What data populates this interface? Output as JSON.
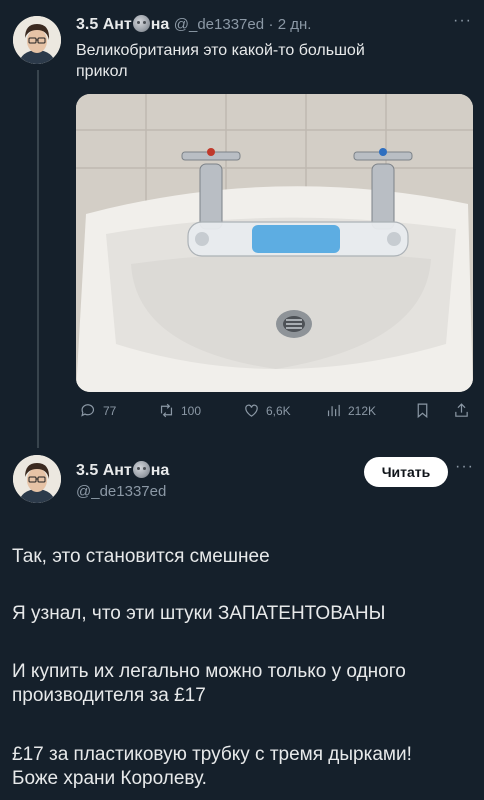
{
  "tweet1": {
    "name_part1": "3.5 Ант",
    "name_part2": "на",
    "handle": "@_de1337ed",
    "time": "· 2 дн.",
    "text_line1": "Великобритания это какой-то большой",
    "text_line2": "прикол",
    "image_alt": "sink-with-plastic-tube",
    "stats": {
      "replies": "77",
      "retweets": "100",
      "likes": "6,6K",
      "views": "212K"
    }
  },
  "tweet2": {
    "name_part1": "3.5 Ант",
    "name_part2": "на",
    "handle": "@_de1337ed",
    "follow_label": "Читать",
    "paragraphs": [
      "Так, это становится смешнее",
      "Я узнал, что эти штуки ЗАПАТЕНТОВАНЫ",
      "И купить их легально можно только у одного",
      "производителя за £17",
      "£17 за пластиковую трубку с тремя дырками!",
      "Боже храни Королеву."
    ]
  },
  "more_glyph": "···",
  "colors": {
    "background": "#15202b",
    "text": "#e7e9ea",
    "muted": "#8b98a5",
    "button": "#ffffff"
  }
}
